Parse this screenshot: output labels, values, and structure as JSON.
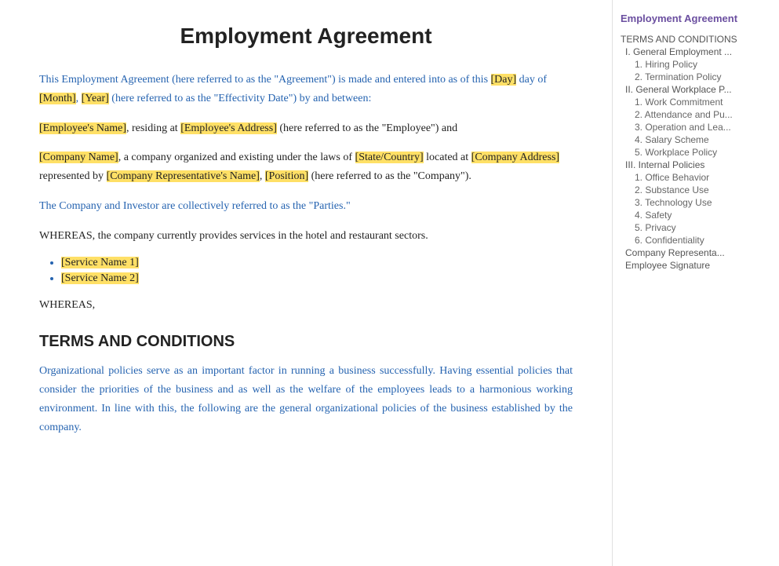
{
  "page": {
    "title": "Employment Agreement"
  },
  "content": {
    "intro_para": "This Employment Agreement (here referred to as the \"Agreement\") is made and entered into as of this [Day] day of [Month], [Year] (here referred to as the \"Effectivity Date\") by and between:",
    "employee_line": "[Employee's Name], residing at [Employee's Address] (here referred to as the \"Employee\") and",
    "company_line_1": "[Company Name], a company organized and existing under the laws of [State/Country] located at [Company Address] represented by [Company Representative's Name], [Position] (here referred to as the \"Company\").",
    "parties_line": "The Company and Investor are collectively referred to as the \"Parties.\"",
    "whereas_1": "WHEREAS, the company currently provides services in the hotel and restaurant sectors.",
    "services": [
      "[Service Name 1]",
      "[Service Name 2]"
    ],
    "whereas_2": "WHEREAS,",
    "section_heading": "TERMS AND CONDITIONS",
    "org_para": "Organizational policies serve as an important factor in running a business successfully. Having essential policies that consider the priorities of the business and as well as the welfare of the employees leads to a harmonious working environment. In line with this, the following are the general organizational policies of the business established by the company."
  },
  "sidebar": {
    "title": "Employment Agreement",
    "items": [
      {
        "label": "TERMS AND CONDITIONS",
        "level": 1
      },
      {
        "label": "I. General Employment ...",
        "level": 2
      },
      {
        "label": "1. Hiring Policy",
        "level": 3
      },
      {
        "label": "2. Termination Policy",
        "level": 3
      },
      {
        "label": "II. General Workplace P...",
        "level": 2
      },
      {
        "label": "1. Work Commitment",
        "level": 3
      },
      {
        "label": "2. Attendance and Pu...",
        "level": 3
      },
      {
        "label": "3.  Operation and Lea...",
        "level": 3
      },
      {
        "label": "4. Salary Scheme",
        "level": 3
      },
      {
        "label": "5.  Workplace Policy",
        "level": 3
      },
      {
        "label": "III. Internal Policies",
        "level": 2
      },
      {
        "label": "1. Office Behavior",
        "level": 3
      },
      {
        "label": "2. Substance Use",
        "level": 3
      },
      {
        "label": "3. Technology Use",
        "level": 3
      },
      {
        "label": "4. Safety",
        "level": 3
      },
      {
        "label": "5. Privacy",
        "level": 3
      },
      {
        "label": "6. Confidentiality",
        "level": 3
      },
      {
        "label": "Company Representa...",
        "level": 2
      },
      {
        "label": "Employee Signature",
        "level": 2
      }
    ]
  }
}
